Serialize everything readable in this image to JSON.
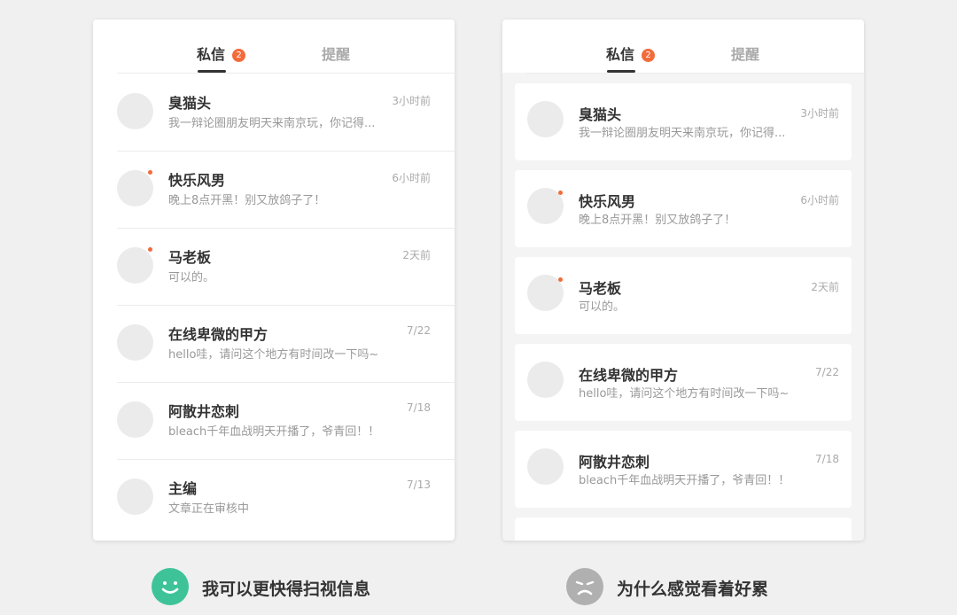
{
  "colors": {
    "accent": "#f26b3a",
    "happy": "#3ec399",
    "sad": "#b0b0b0",
    "tab_active": "#333333",
    "tab_inactive": "#aaaaaa"
  },
  "tabs": {
    "dm_label": "私信",
    "dm_badge": "2",
    "remind_label": "提醒"
  },
  "left_list": [
    {
      "name": "臭猫头",
      "preview": "我一辩论圈朋友明天来南京玩，你记得...",
      "time": "3小时前",
      "unread": false
    },
    {
      "name": "快乐风男",
      "preview": "晚上8点开黑！别又放鸽子了！",
      "time": "6小时前",
      "unread": true
    },
    {
      "name": "马老板",
      "preview": "可以的。",
      "time": "2天前",
      "unread": true
    },
    {
      "name": "在线卑微的甲方",
      "preview": "hello哇，请问这个地方有时间改一下吗~",
      "time": "7/22",
      "unread": false
    },
    {
      "name": "阿散井恋刺",
      "preview": "bleach千年血战明天开播了，爷青回！！",
      "time": "7/18",
      "unread": false
    },
    {
      "name": "主编",
      "preview": "文章正在审核中",
      "time": "7/13",
      "unread": false
    }
  ],
  "right_list": [
    {
      "name": "臭猫头",
      "preview": "我一辩论圈朋友明天来南京玩，你记得...",
      "time": "3小时前",
      "unread": false
    },
    {
      "name": "快乐风男",
      "preview": "晚上8点开黑！别又放鸽子了！",
      "time": "6小时前",
      "unread": true
    },
    {
      "name": "马老板",
      "preview": "可以的。",
      "time": "2天前",
      "unread": true
    },
    {
      "name": "在线卑微的甲方",
      "preview": "hello哇，请问这个地方有时间改一下吗~",
      "time": "7/22",
      "unread": false
    },
    {
      "name": "阿散井恋刺",
      "preview": "bleach千年血战明天开播了，爷青回！！",
      "time": "7/18",
      "unread": false
    }
  ],
  "captions": {
    "good": {
      "icon": "smile-face-icon",
      "text": "我可以更快得扫视信息"
    },
    "bad": {
      "icon": "sad-face-icon",
      "text": "为什么感觉看着好累"
    }
  }
}
